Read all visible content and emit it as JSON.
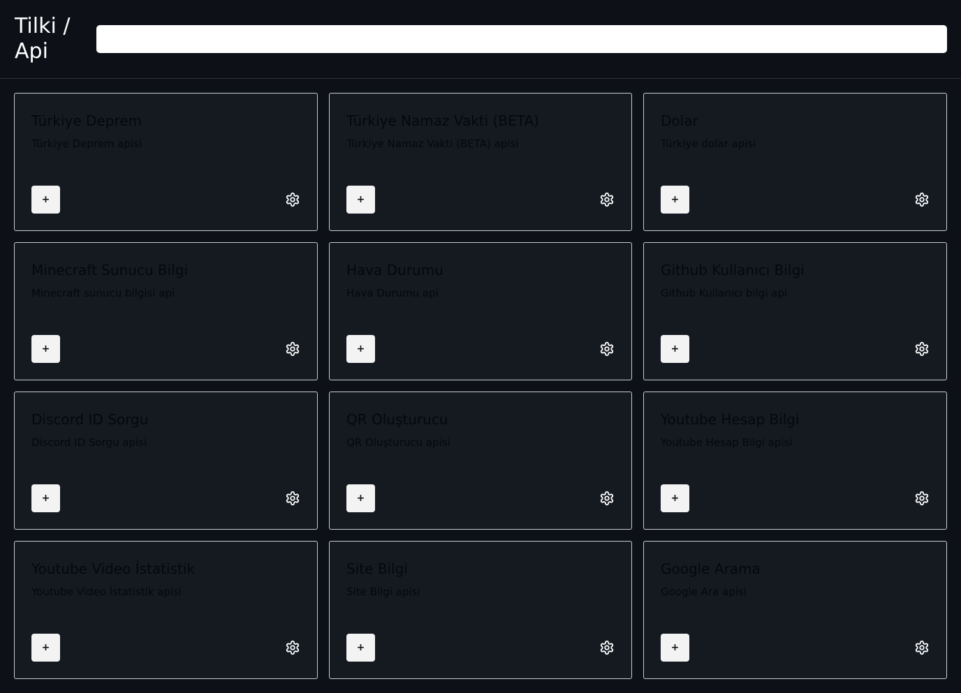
{
  "header": {
    "brand_line1": "Tilki /",
    "brand_line2": "Api",
    "search": {
      "value": "",
      "placeholder": ""
    }
  },
  "cards": [
    {
      "title": "Türkiye Deprem",
      "description": "Türkiye Deprem apisi",
      "add_label": "+",
      "icon": "gear-icon"
    },
    {
      "title": "Türkiye Namaz Vakti (BETA)",
      "description": "Türkiye Namaz Vakti (BETA) apisi",
      "add_label": "+",
      "icon": "gear-icon"
    },
    {
      "title": "Dolar",
      "description": "Türkiye dolar apisi",
      "add_label": "+",
      "icon": "gear-icon"
    },
    {
      "title": "Minecraft Sunucu Bilgi",
      "description": "Minecraft sunucu bilgisi api",
      "add_label": "+",
      "icon": "gear-icon"
    },
    {
      "title": "Hava Durumu",
      "description": "Hava Durumu api",
      "add_label": "+",
      "icon": "gear-icon"
    },
    {
      "title": "Github Kullanıcı Bilgi",
      "description": "Github Kullanıcı bilgi api",
      "add_label": "+",
      "icon": "gear-icon"
    },
    {
      "title": "Discord ID Sorgu",
      "description": "Discord ID Sorgu apisi",
      "add_label": "+",
      "icon": "gear-icon"
    },
    {
      "title": "QR Oluşturucu",
      "description": "QR Oluşturucu apisi",
      "add_label": "+",
      "icon": "gear-icon"
    },
    {
      "title": "Youtube Hesap Bilgi",
      "description": "Youtube Hesap Bilgi apisi",
      "add_label": "+",
      "icon": "gear-icon"
    },
    {
      "title": "Youtube Video İstatistik",
      "description": "Youtube Video İstatistik apisi",
      "add_label": "+",
      "icon": "gear-icon"
    },
    {
      "title": "Site Bilgi",
      "description": "Site Bilgi apisi",
      "add_label": "+",
      "icon": "gear-icon"
    },
    {
      "title": "Google Arama",
      "description": "Google Ara apisi",
      "add_label": "+",
      "icon": "gear-icon"
    }
  ],
  "colors": {
    "background": "#0d1117",
    "card_background": "#151a21",
    "card_border": "#c9cdd3",
    "text_primary": "#ffffff"
  }
}
